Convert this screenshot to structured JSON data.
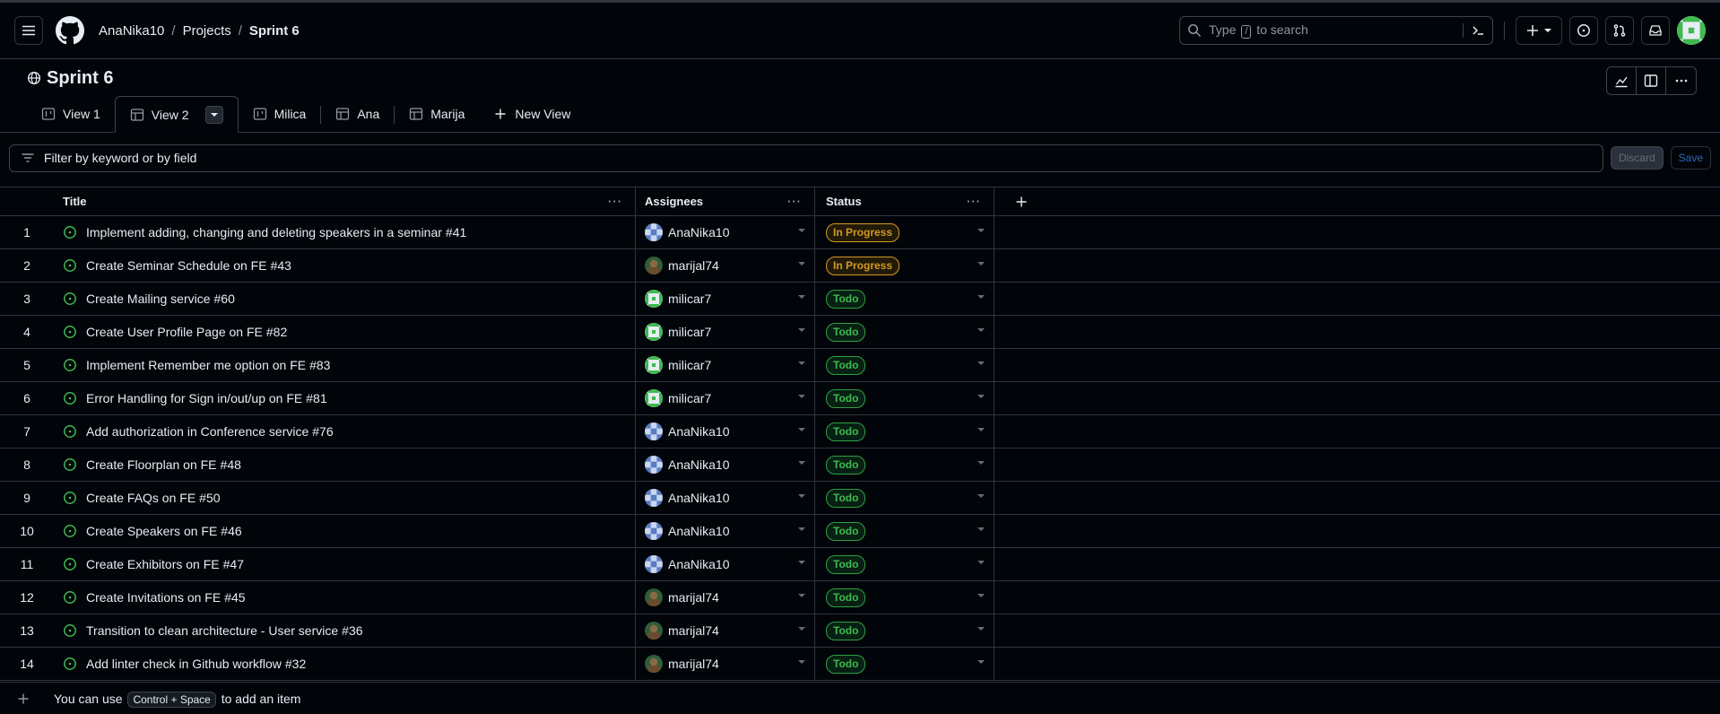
{
  "nav": {
    "breadcrumb": [
      "AnaNika10",
      "Projects",
      "Sprint 6"
    ],
    "search_prefix": "Type",
    "search_key": "/",
    "search_suffix": "to search"
  },
  "project": {
    "title": "Sprint 6"
  },
  "tabs": [
    {
      "label": "View 1",
      "icon": "board-icon"
    },
    {
      "label": "View 2",
      "icon": "table-icon",
      "active": true
    },
    {
      "label": "Milica",
      "icon": "board-icon"
    },
    {
      "label": "Ana",
      "icon": "table-icon"
    },
    {
      "label": "Marija",
      "icon": "table-icon"
    },
    {
      "label": "New View",
      "icon": "plus-icon"
    }
  ],
  "filter": {
    "placeholder": "Filter by keyword or by field",
    "discard_label": "Discard",
    "save_label": "Save"
  },
  "columns": {
    "title": "Title",
    "assignees": "Assignees",
    "status": "Status"
  },
  "rows": [
    {
      "n": "1",
      "title": "Implement adding, changing and deleting speakers in a seminar",
      "num": "#41",
      "assignee": "AnaNika10",
      "status": "In Progress"
    },
    {
      "n": "2",
      "title": "Create Seminar Schedule on FE",
      "num": "#43",
      "assignee": "marijal74",
      "status": "In Progress"
    },
    {
      "n": "3",
      "title": "Create Mailing service",
      "num": "#60",
      "assignee": "milicar7",
      "status": "Todo"
    },
    {
      "n": "4",
      "title": "Create User Profile Page on FE",
      "num": "#82",
      "assignee": "milicar7",
      "status": "Todo"
    },
    {
      "n": "5",
      "title": "Implement Remember me option on FE",
      "num": "#83",
      "assignee": "milicar7",
      "status": "Todo"
    },
    {
      "n": "6",
      "title": "Error Handling for Sign in/out/up on FE",
      "num": "#81",
      "assignee": "milicar7",
      "status": "Todo"
    },
    {
      "n": "7",
      "title": "Add authorization in Conference service",
      "num": "#76",
      "assignee": "AnaNika10",
      "status": "Todo"
    },
    {
      "n": "8",
      "title": "Create Floorplan on FE",
      "num": "#48",
      "assignee": "AnaNika10",
      "status": "Todo"
    },
    {
      "n": "9",
      "title": "Create FAQs on FE",
      "num": "#50",
      "assignee": "AnaNika10",
      "status": "Todo"
    },
    {
      "n": "10",
      "title": "Create Speakers on FE",
      "num": "#46",
      "assignee": "AnaNika10",
      "status": "Todo"
    },
    {
      "n": "11",
      "title": "Create Exhibitors on FE",
      "num": "#47",
      "assignee": "AnaNika10",
      "status": "Todo"
    },
    {
      "n": "12",
      "title": "Create Invitations on FE",
      "num": "#45",
      "assignee": "marijal74",
      "status": "Todo"
    },
    {
      "n": "13",
      "title": "Transition to clean architecture - User service",
      "num": "#36",
      "assignee": "marijal74",
      "status": "Todo"
    },
    {
      "n": "14",
      "title": "Add linter check in Github workflow",
      "num": "#32",
      "assignee": "marijal74",
      "status": "Todo"
    }
  ],
  "footer": {
    "prefix": "You can use",
    "shortcut": "Control + Space",
    "suffix": "to add an item"
  },
  "colors": {
    "background": "#010409",
    "border": "#30363d",
    "in_progress": "#d29922",
    "todo": "#3fb950",
    "open_issue": "#3fb950"
  }
}
